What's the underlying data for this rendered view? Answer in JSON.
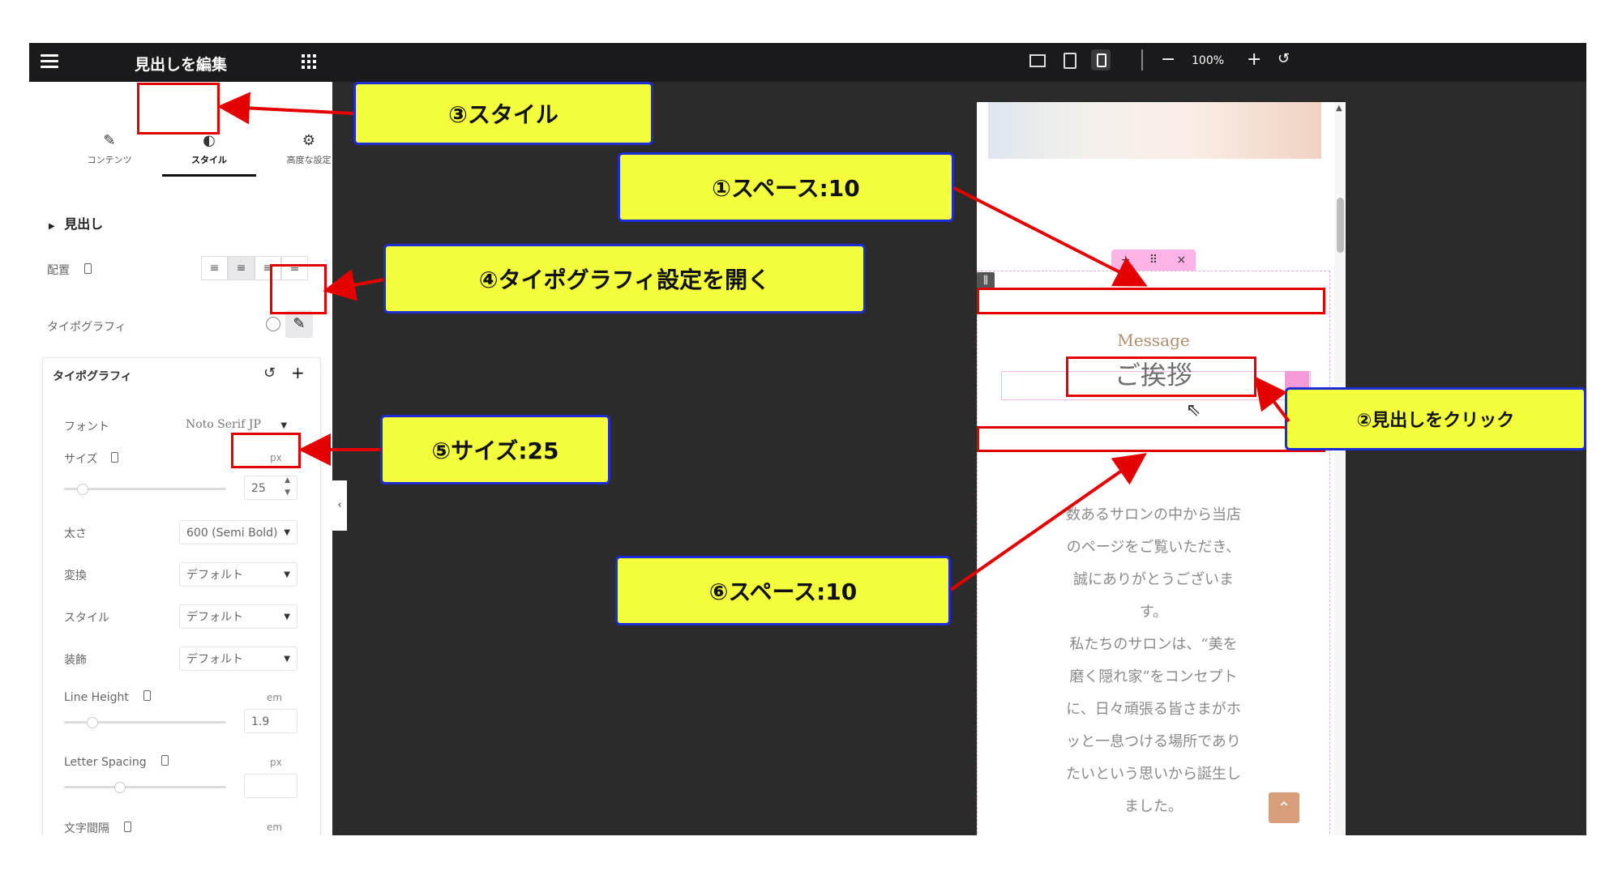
{
  "editor": {
    "title": "見出しを編集",
    "tabs": [
      {
        "label": "コンテンツ",
        "icon": "pencil-icon"
      },
      {
        "label": "スタイル",
        "icon": "contrast-icon"
      },
      {
        "label": "高度な設定",
        "icon": "gear-icon"
      }
    ],
    "section_title": "見出し",
    "alignment_label": "配置",
    "typography_label": "タイポグラフィ",
    "typography_popup": {
      "title": "タイポグラフィ",
      "font_label": "フォント",
      "font_value": "Noto Serif JP",
      "size_label": "サイズ",
      "size_unit": "px",
      "size_value": "25",
      "weight_label": "太さ",
      "weight_value": "600 (Semi Bold)",
      "transform_label": "変換",
      "transform_value": "デフォルト",
      "style_label": "スタイル",
      "style_value": "デフォルト",
      "decoration_label": "装飾",
      "decoration_value": "デフォルト",
      "line_height_label": "Line Height",
      "line_height_unit": "em",
      "line_height_value": "1.9",
      "letter_spacing_label": "Letter Spacing",
      "letter_spacing_unit": "px",
      "word_spacing_label": "文字間隔",
      "word_spacing_unit": "em"
    }
  },
  "toolbar": {
    "zoom": "100%",
    "devices": [
      "desktop-icon",
      "tablet-icon",
      "mobile-icon"
    ]
  },
  "preview": {
    "message": "Message",
    "heading": "ご挨拶",
    "body_lines": [
      "数あるサロンの中から当店",
      "のページをご覧いただき、",
      "誠にありがとうございま",
      "す。",
      "私たちのサロンは、“美を",
      "磨く隠れ家”をコンセプト",
      "に、日々頑張る皆さまがホ",
      "ッと一息つける場所であり",
      "たいという思いから誕生し",
      "ました。"
    ],
    "tool_icons": [
      "+",
      "⠿",
      "×"
    ]
  },
  "annotations": {
    "c1": "①スペース:10",
    "c2": "②見出しをクリック",
    "c3": "③スタイル",
    "c4": "④タイポグラフィ設定を開く",
    "c5": "⑤サイズ:25",
    "c6": "⑥スペース:10"
  },
  "colors": {
    "callout_fill": "#f3ff3c",
    "callout_border": "#1c2dd6",
    "annotation_red": "#e50000"
  }
}
